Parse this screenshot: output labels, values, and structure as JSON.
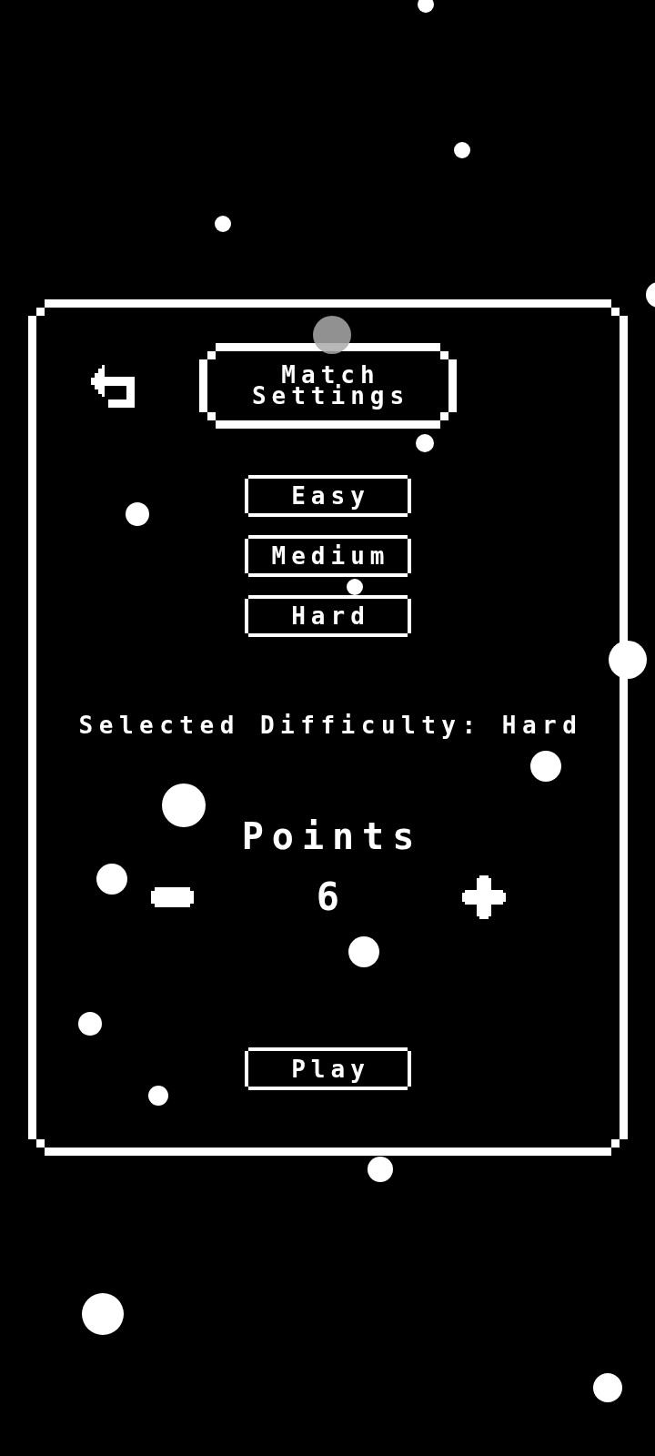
{
  "header": {
    "title": "Match Settings"
  },
  "difficulty_buttons": [
    {
      "label": "Easy"
    },
    {
      "label": "Medium"
    },
    {
      "label": "Hard"
    }
  ],
  "selected_difficulty": "Selected Difficulty: Hard",
  "points": {
    "label": "Points",
    "value": "6"
  },
  "play_button": {
    "label": "Play"
  }
}
